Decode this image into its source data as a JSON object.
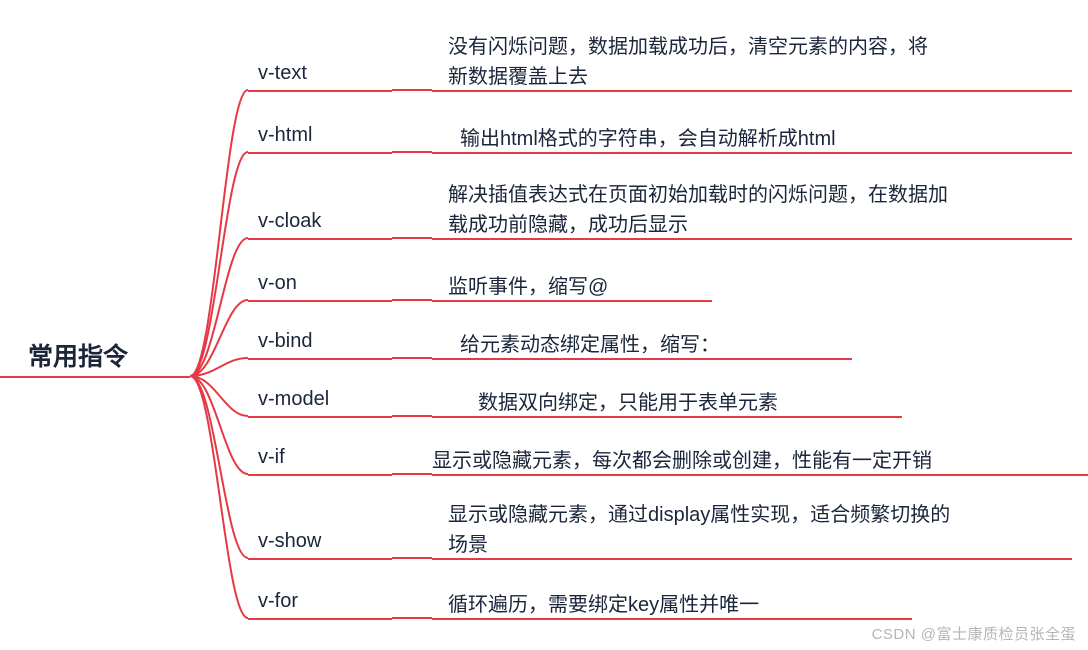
{
  "root": {
    "title": "常用指令"
  },
  "branches": [
    {
      "label": "v-text",
      "desc": "没有闪烁问题，数据加载成功后，清空元素的内容，将新数据覆盖上去"
    },
    {
      "label": "v-html",
      "desc": "输出html格式的字符串，会自动解析成html"
    },
    {
      "label": "v-cloak",
      "desc": "解决插值表达式在页面初始加载时的闪烁问题，在数据加载成功前隐藏，成功后显示"
    },
    {
      "label": "v-on",
      "desc": "监听事件，缩写@"
    },
    {
      "label": "v-bind",
      "desc": "给元素动态绑定属性，缩写："
    },
    {
      "label": "v-model",
      "desc": "数据双向绑定，只能用于表单元素"
    },
    {
      "label": "v-if",
      "desc": "显示或隐藏元素，每次都会删除或创建，性能有一定开销"
    },
    {
      "label": "v-show",
      "desc": "显示或隐藏元素，通过display属性实现，适合频繁切换的场景"
    },
    {
      "label": "v-for",
      "desc": "循环遍历，需要绑定key属性并唯一"
    }
  ],
  "watermark": "CSDN @富士康质检员张全蛋",
  "colors": {
    "line": "#e63946",
    "text": "#1b263b"
  }
}
